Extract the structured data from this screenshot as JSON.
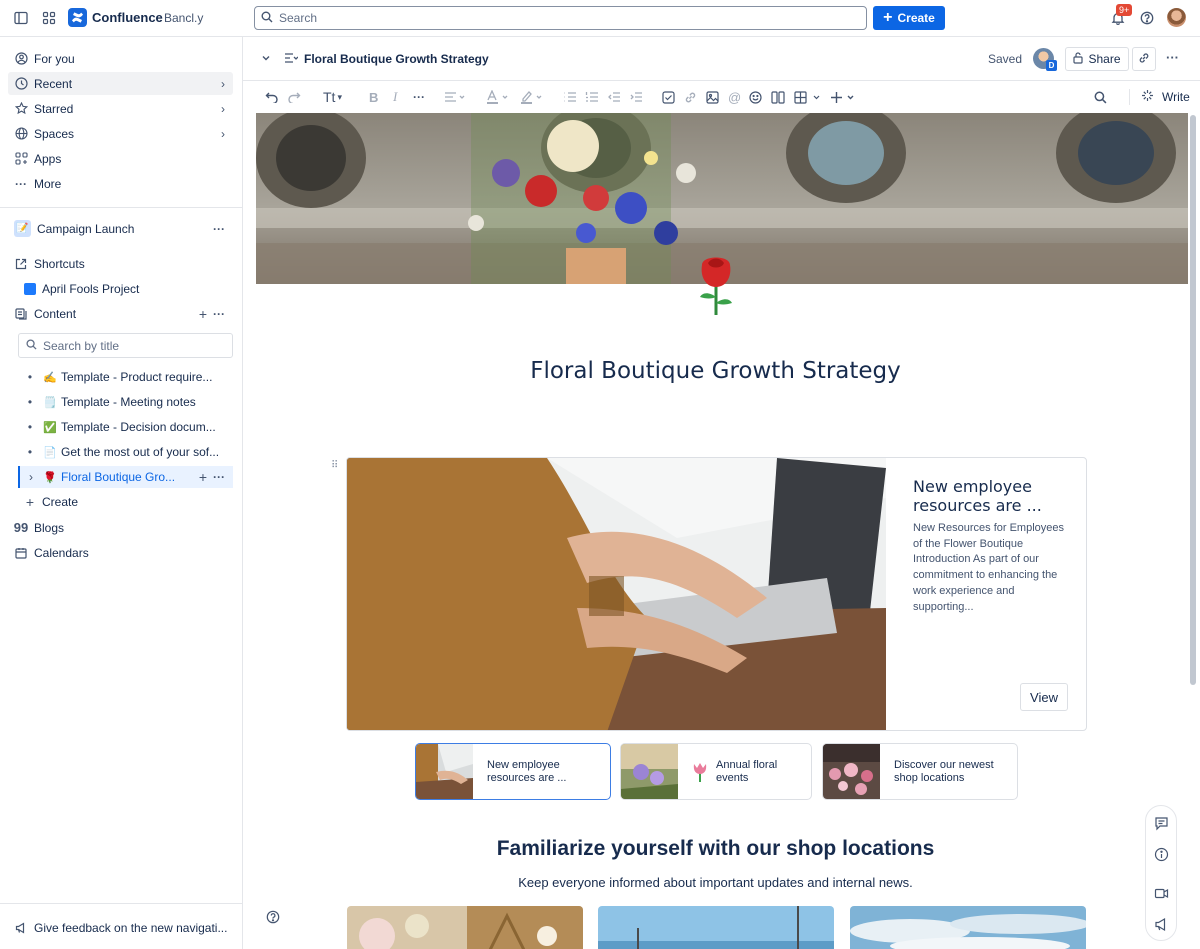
{
  "topbar": {
    "app_name": "Confluence",
    "site_name": "Bancl.y",
    "search_placeholder": "Search",
    "create_label": "Create",
    "notifications_badge": "9+"
  },
  "sidebar": {
    "nav": [
      {
        "label": "For you",
        "icon": "user-circle-icon"
      },
      {
        "label": "Recent",
        "icon": "clock-icon"
      },
      {
        "label": "Starred",
        "icon": "star-icon"
      },
      {
        "label": "Spaces",
        "icon": "globe-icon"
      },
      {
        "label": "Apps",
        "icon": "apps-icon"
      },
      {
        "label": "More",
        "icon": "more-icon"
      }
    ],
    "space_name": "Campaign Launch",
    "shortcuts_label": "Shortcuts",
    "shortcut_item": "April Fools Project",
    "content_label": "Content",
    "search_placeholder": "Search by title",
    "tree": [
      {
        "emoji": "✍️",
        "label": "Template - Product require..."
      },
      {
        "emoji": "🗒️",
        "label": "Template - Meeting notes"
      },
      {
        "emoji": "✅",
        "label": "Template - Decision docum..."
      },
      {
        "emoji": "📄",
        "label": "Get the most out of your sof..."
      },
      {
        "emoji": "🌹",
        "label": "Floral Boutique Gro..."
      }
    ],
    "create_label": "Create",
    "blogs_label": "Blogs",
    "calendars_label": "Calendars",
    "feedback_label": "Give feedback on the new navigati..."
  },
  "header": {
    "page_title": "Floral Boutique Growth Strategy",
    "saved_label": "Saved",
    "share_label": "Share",
    "avatar_letter": "D"
  },
  "toolbar": {
    "text_style": "Tt",
    "write_label": "Write"
  },
  "page": {
    "title": "Floral Boutique Growth Strategy",
    "card": {
      "title": "New employee resources are ...",
      "description": "New Resources for Employees of the Flower Boutique Introduction As part of our commitment to enhancing the work experience and supporting...",
      "button": "View"
    },
    "mini_cards": [
      {
        "label": "New employee resources are ..."
      },
      {
        "label": "Annual floral events"
      },
      {
        "label": "Discover our newest shop locations"
      }
    ],
    "section_title": "Familiarize yourself with our shop locations",
    "section_subtitle": "Keep everyone informed about important updates and internal news."
  },
  "colors": {
    "brand": "#0c66e4",
    "badge": "#e34935",
    "selected_bg": "#e9f2ff"
  }
}
